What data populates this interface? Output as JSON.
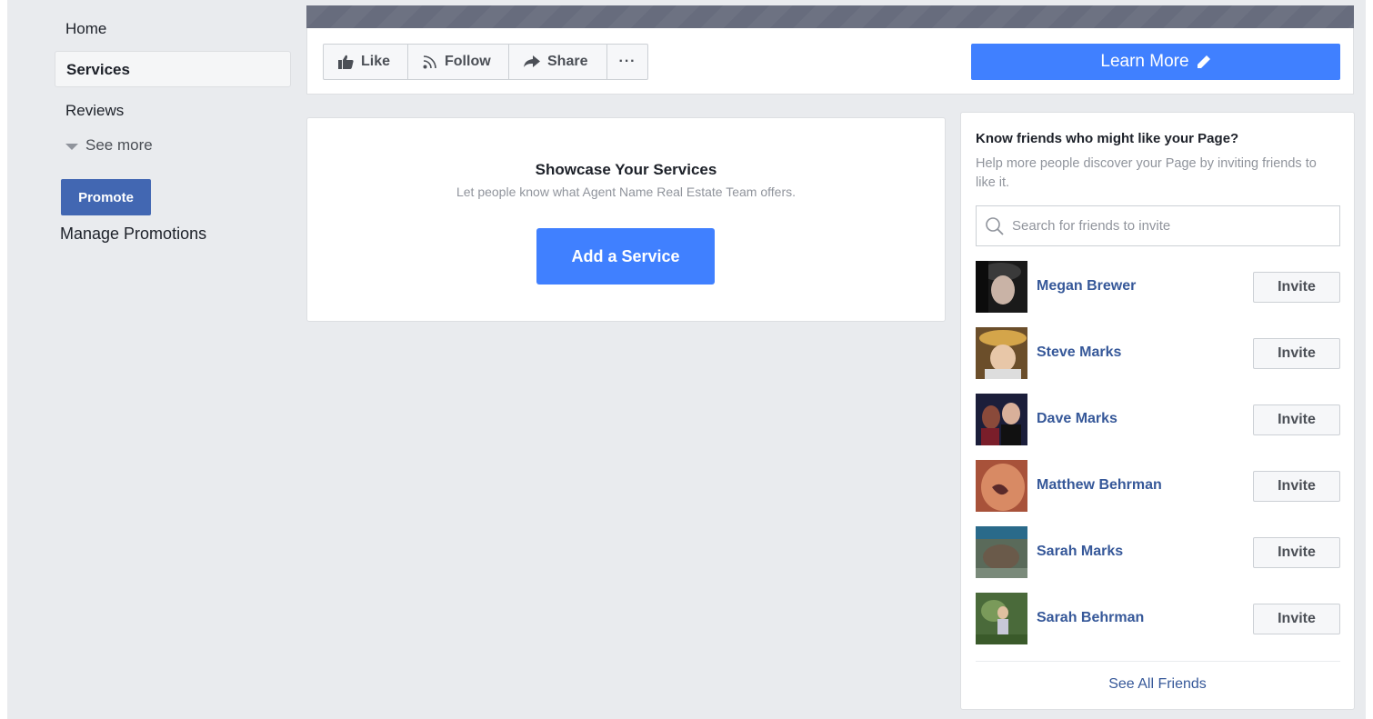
{
  "left_nav": {
    "items": [
      {
        "label": "Home"
      },
      {
        "label": "Services",
        "active": true
      },
      {
        "label": "Reviews"
      }
    ],
    "see_more": "See more",
    "promote_label": "Promote",
    "manage_promotions": "Manage Promotions"
  },
  "action_bar": {
    "like_label": "Like",
    "follow_label": "Follow",
    "share_label": "Share",
    "more_label": "···",
    "learn_more_label": "Learn More"
  },
  "showcase": {
    "title": "Showcase Your Services",
    "description": "Let people know what Agent Name Real Estate Team offers.",
    "button_label": "Add a Service"
  },
  "invite_card": {
    "title": "Know friends who might like your Page?",
    "subtitle": "Help more people discover your Page by inviting friends to like it.",
    "search_placeholder": "Search for friends to invite",
    "invite_label": "Invite",
    "friends": [
      {
        "name": "Megan Brewer"
      },
      {
        "name": "Steve Marks"
      },
      {
        "name": "Dave Marks"
      },
      {
        "name": "Matthew Behrman"
      },
      {
        "name": "Sarah Marks"
      },
      {
        "name": "Sarah Behrman"
      }
    ],
    "see_all": "See All Friends"
  },
  "colors": {
    "brand_blue": "#4080ff",
    "promote_blue": "#4267b2",
    "link_blue": "#365899",
    "page_bg": "#e9ebee"
  }
}
